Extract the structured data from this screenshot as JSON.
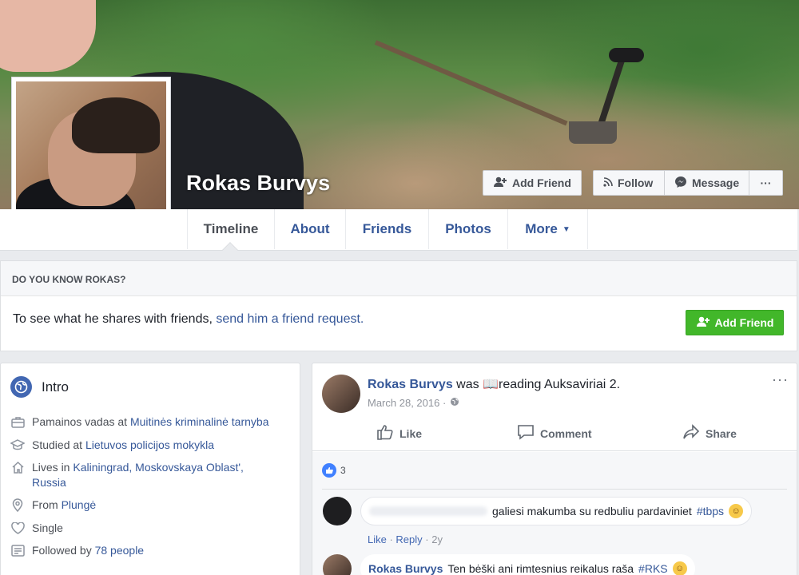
{
  "profile": {
    "name": "Rokas Burvys",
    "buttons": {
      "add_friend": "Add Friend",
      "follow": "Follow",
      "message": "Message",
      "more": "···"
    }
  },
  "tabs": [
    {
      "label": "Timeline"
    },
    {
      "label": "About"
    },
    {
      "label": "Friends"
    },
    {
      "label": "Photos"
    },
    {
      "label": "More"
    }
  ],
  "know": {
    "heading": "DO YOU KNOW ROKAS?",
    "text": "To see what he shares with friends,",
    "link": "send him a friend request.",
    "button": "Add Friend"
  },
  "intro": {
    "title": "Intro",
    "work_prefix": "Pamainos vadas at",
    "work_link": "Muitinės kriminalinė tarnyba",
    "study_prefix": "Studied at",
    "study_link": "Lietuvos policijos mokykla",
    "lives_prefix": "Lives in",
    "lives_link": "Kaliningrad, Moskovskaya Oblast',",
    "lives_link2": "Russia",
    "from_prefix": "From",
    "from_link": "Plungė",
    "relationship": "Single",
    "followed_prefix": "Followed by",
    "followed_link": "78 people"
  },
  "post": {
    "author": "Rokas Burvys",
    "was": "was",
    "activity": "reading Auksaviriai 2.",
    "date": "March 28, 2016 ·",
    "menu": "···",
    "actions": {
      "like": "Like",
      "comment": "Comment",
      "share": "Share"
    },
    "likes_count": "3",
    "comment1": {
      "text": "galiesi makumba su redbuliu pardaviniet",
      "tag": "#tbps",
      "like": "Like",
      "reply": "Reply",
      "time": "2y"
    },
    "comment2": {
      "author": "Rokas Burvys",
      "text": "Ten bėški ani rimtesnius reikalus raša",
      "tag": "#RKS"
    }
  },
  "colors": {
    "link": "#365899",
    "green": "#42b72a",
    "like_blue": "#4080ff"
  }
}
